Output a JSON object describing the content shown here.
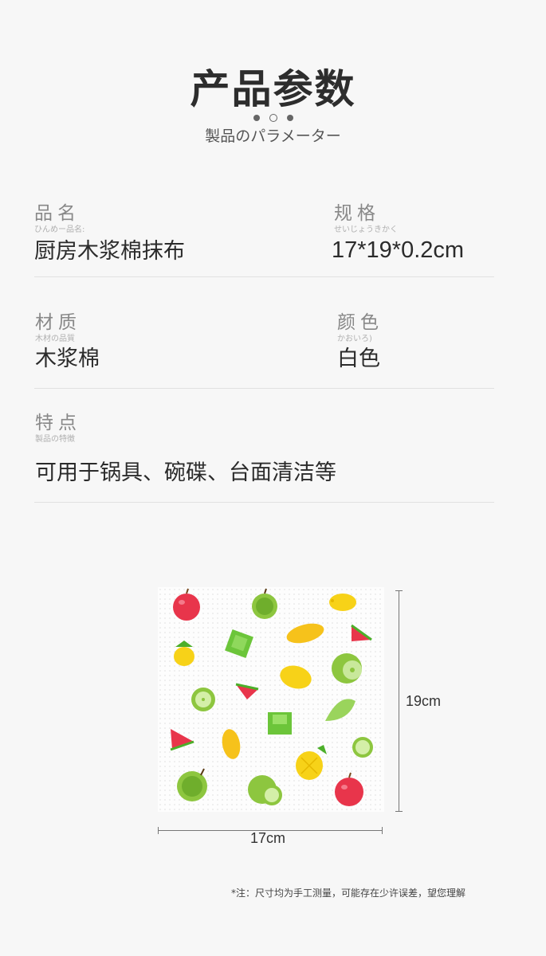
{
  "header": {
    "title": "产品参数",
    "subtitle": "製品のパラメーター"
  },
  "params": {
    "name": {
      "label": "品名",
      "ruby": "ひんめー品名:",
      "value": "厨房木浆棉抹布"
    },
    "size": {
      "label": "规格",
      "ruby": "せいじょうきかく",
      "value": "17*19*0.2cm"
    },
    "material": {
      "label": "材质",
      "ruby": "木材の品質",
      "value": "木浆棉"
    },
    "color": {
      "label": "颜色",
      "ruby": "かおいろ)",
      "value": "白色"
    },
    "feature": {
      "label": "特点",
      "ruby": "製品の特徴",
      "value": "可用于锅具、碗碟、台面清洁等"
    }
  },
  "dimensions": {
    "width_label": "17cm",
    "height_label": "19cm"
  },
  "product_image": {
    "pattern": [
      "apple-icon",
      "durian-icon",
      "lemon-icon",
      "mango-icon",
      "watermelon-icon",
      "pineapple-icon",
      "green-cube-icon",
      "lime-icon"
    ],
    "colors": {
      "red": "#e8354b",
      "green": "#6cc53a",
      "yellow": "#f7d218",
      "pale": "#fdfdfd"
    }
  },
  "note": "*注：尺寸均为手工测量，可能存在少许误差，望您理解"
}
